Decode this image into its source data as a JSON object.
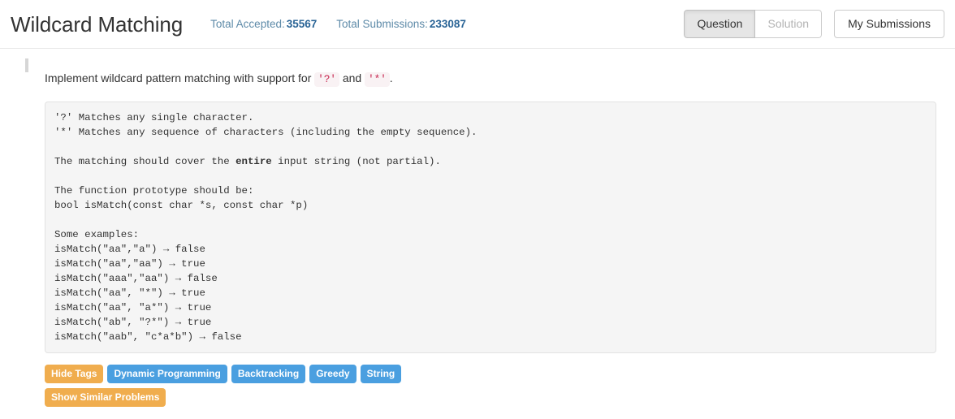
{
  "header": {
    "title": "Wildcard Matching",
    "stats": [
      {
        "label": "Total Accepted:",
        "value": "35567"
      },
      {
        "label": "Total Submissions:",
        "value": "233087"
      }
    ],
    "toggle": {
      "question_label": "Question",
      "solution_label": "Solution"
    },
    "my_submissions_label": "My Submissions"
  },
  "description": {
    "lead": "Implement wildcard pattern matching with support for ",
    "code1": "'?'",
    "conjunction": " and ",
    "code2": "'*'",
    "trailing": "."
  },
  "codeblock": {
    "line1": "'?' Matches any single character.",
    "line2": "'*' Matches any sequence of characters (including the empty sequence).",
    "line3": "",
    "line4_pre": "The matching should cover the ",
    "line4_bold": "entire",
    "line4_post": " input string (not partial).",
    "line5": "",
    "line6": "The function prototype should be:",
    "line7": "bool isMatch(const char *s, const char *p)",
    "line8": "",
    "line9": "Some examples:",
    "line10": "isMatch(\"aa\",\"a\") → false",
    "line11": "isMatch(\"aa\",\"aa\") → true",
    "line12": "isMatch(\"aaa\",\"aa\") → false",
    "line13": "isMatch(\"aa\", \"*\") → true",
    "line14": "isMatch(\"aa\", \"a*\") → true",
    "line15": "isMatch(\"ab\", \"?*\") → true",
    "line16": "isMatch(\"aab\", \"c*a*b\") → false"
  },
  "tags": {
    "row1": [
      {
        "label": "Hide Tags",
        "style": "warning"
      },
      {
        "label": "Dynamic Programming",
        "style": "info"
      },
      {
        "label": "Backtracking",
        "style": "info"
      },
      {
        "label": "Greedy",
        "style": "info"
      },
      {
        "label": "String",
        "style": "info"
      }
    ],
    "row2": [
      {
        "label": "Show Similar Problems",
        "style": "warning"
      }
    ]
  },
  "colors": {
    "warning": "#f0ad4e",
    "info": "#4a9fe0",
    "stat_label": "#5d8aa8",
    "stat_value": "#2a6496",
    "inline_code_text": "#c7254e",
    "inline_code_bg": "#f9f2f4",
    "codeblock_bg": "#f5f5f5"
  }
}
